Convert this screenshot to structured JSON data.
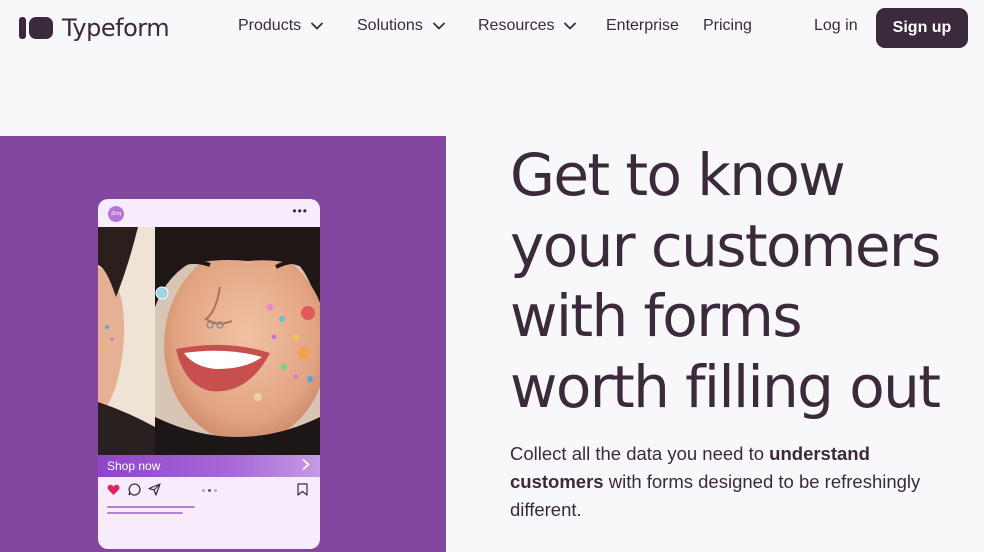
{
  "brand": {
    "name": "Typeform"
  },
  "nav": {
    "items": [
      {
        "label": "Products",
        "has_dropdown": true
      },
      {
        "label": "Solutions",
        "has_dropdown": true
      },
      {
        "label": "Resources",
        "has_dropdown": true
      },
      {
        "label": "Enterprise",
        "has_dropdown": false
      },
      {
        "label": "Pricing",
        "has_dropdown": false
      }
    ],
    "login_label": "Log in",
    "signup_label": "Sign up"
  },
  "hero": {
    "headline": "Get to know your customers with forms worth filling out",
    "subtext_1": "Collect all the data you need to ",
    "subtext_bold": "understand customers",
    "subtext_2": " with forms designed to be refreshingly different.",
    "mockup": {
      "avatar_text": "Zinq",
      "more_icon": "more-horizontal-icon",
      "shop_label": "Shop now",
      "icons": [
        "heart-icon",
        "comment-icon",
        "send-icon",
        "bookmark-icon"
      ]
    }
  },
  "colors": {
    "ink": "#3b2a3b",
    "panel_purple": "#83479f",
    "page_bg": "#f8f7fa",
    "heart_red": "#e0245e"
  }
}
